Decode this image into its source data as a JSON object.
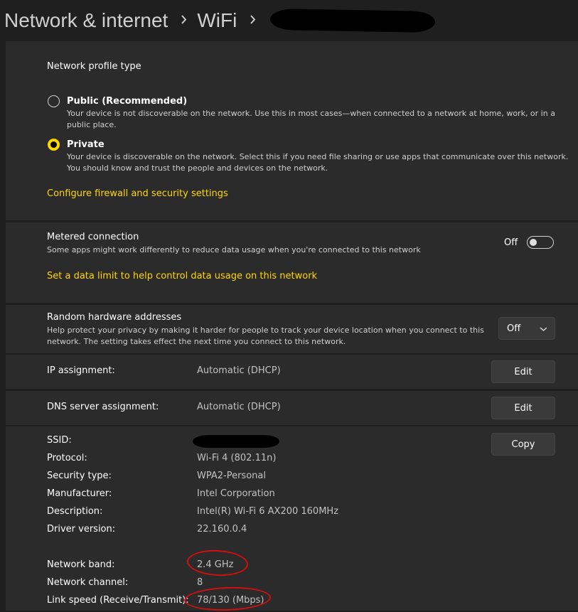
{
  "breadcrumb": {
    "root": "Network & internet",
    "second": "WiFi"
  },
  "profile": {
    "heading": "Network profile type",
    "options": [
      {
        "label": "Public (Recommended)",
        "desc": "Your device is not discoverable on the network. Use this in most cases—when connected to a network at home, work, or in a public place.",
        "selected": false
      },
      {
        "label": "Private",
        "desc": "Your device is discoverable on the network. Select this if you need file sharing or use apps that communicate over this network. You should know and trust the people and devices on the network.",
        "selected": true
      }
    ],
    "firewall_link": "Configure firewall and security settings"
  },
  "metered": {
    "title": "Metered connection",
    "desc": "Some apps might work differently to reduce data usage when you're connected to this network",
    "state_label": "Off",
    "data_limit_link": "Set a data limit to help control data usage on this network"
  },
  "random_hw": {
    "title": "Random hardware addresses",
    "desc": "Help protect your privacy by making it harder for people to track your device location when you connect to this network. The setting takes effect the next time you connect to this network.",
    "selected": "Off"
  },
  "ip": {
    "label": "IP assignment:",
    "value": "Automatic (DHCP)",
    "button": "Edit"
  },
  "dns": {
    "label": "DNS server assignment:",
    "value": "Automatic (DHCP)",
    "button": "Edit"
  },
  "props": {
    "copy_button": "Copy",
    "rows": [
      {
        "label": "SSID:",
        "value": ""
      },
      {
        "label": "Protocol:",
        "value": "Wi-Fi 4 (802.11n)"
      },
      {
        "label": "Security type:",
        "value": "WPA2-Personal"
      },
      {
        "label": "Manufacturer:",
        "value": "Intel Corporation"
      },
      {
        "label": "Description:",
        "value": "Intel(R) Wi-Fi 6 AX200 160MHz"
      },
      {
        "label": "Driver version:",
        "value": "22.160.0.4"
      },
      {
        "label": "Network band:",
        "value": "2.4 GHz"
      },
      {
        "label": "Network channel:",
        "value": "8"
      },
      {
        "label": "Link speed (Receive/Transmit):",
        "value": "78/130 (Mbps)"
      }
    ]
  },
  "colors": {
    "accent": "#ffd600",
    "annotation": "#d01010"
  }
}
